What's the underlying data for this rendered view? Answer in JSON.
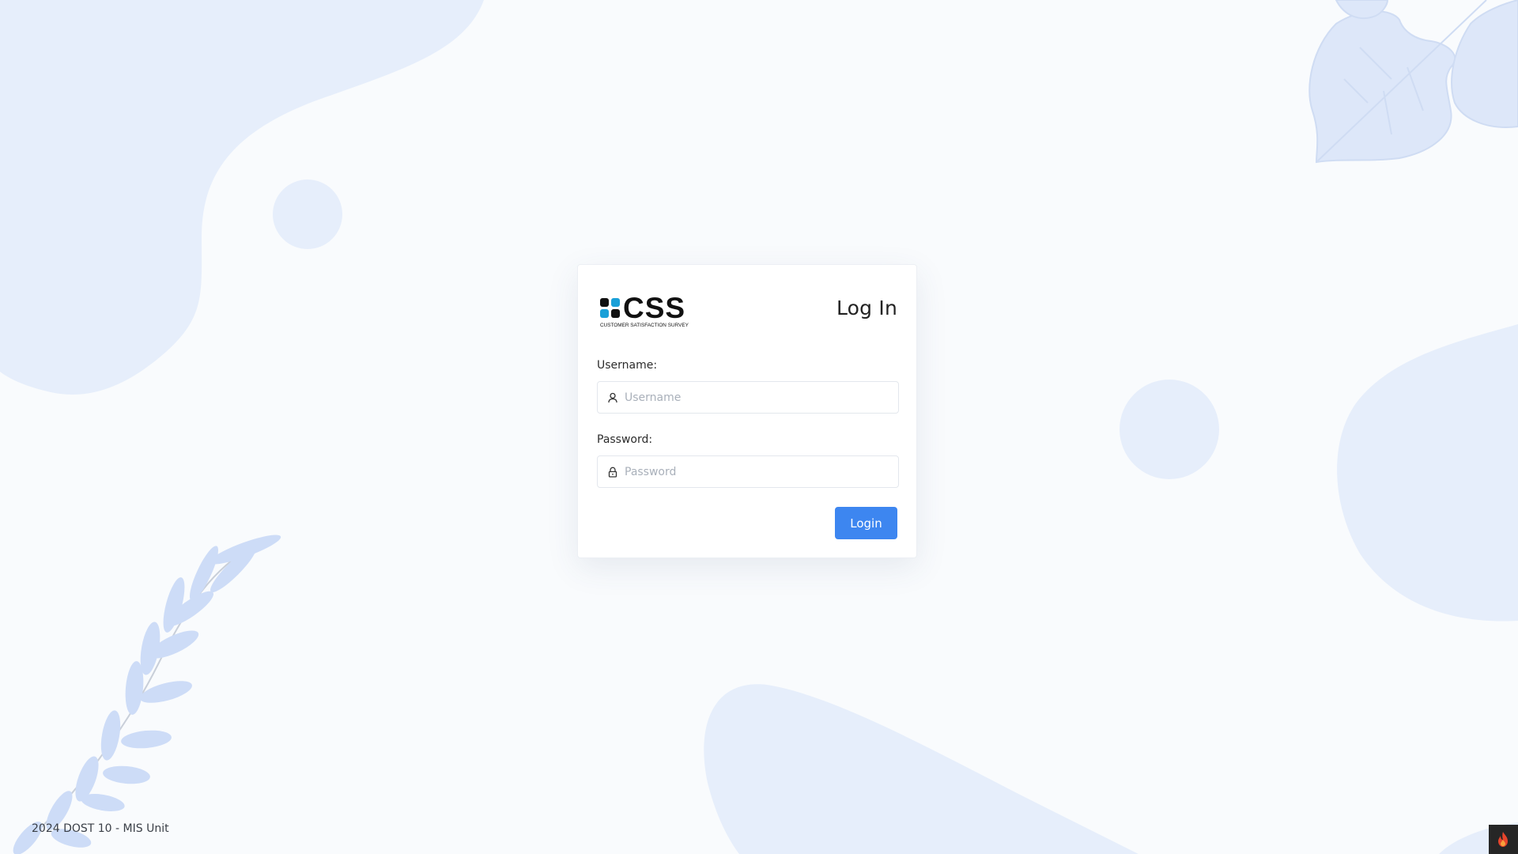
{
  "login": {
    "title": "Log In",
    "username_label": "Username:",
    "username_placeholder": "Username",
    "username_value": "",
    "password_label": "Password:",
    "password_placeholder": "Password",
    "password_value": "",
    "submit_label": "Login"
  },
  "brand": {
    "logo_text": "CSS",
    "logo_subtitle": "CUSTOMER SATISFACTION SURVEY"
  },
  "footer": {
    "text": "2024 DOST 10 - MIS Unit"
  },
  "icons": {
    "username": "user-icon",
    "password": "lock-icon",
    "corner": "flame-icon"
  },
  "colors": {
    "accent": "#3d86f0",
    "background": "#f9fbfd",
    "decoration": "#e6eefb"
  }
}
